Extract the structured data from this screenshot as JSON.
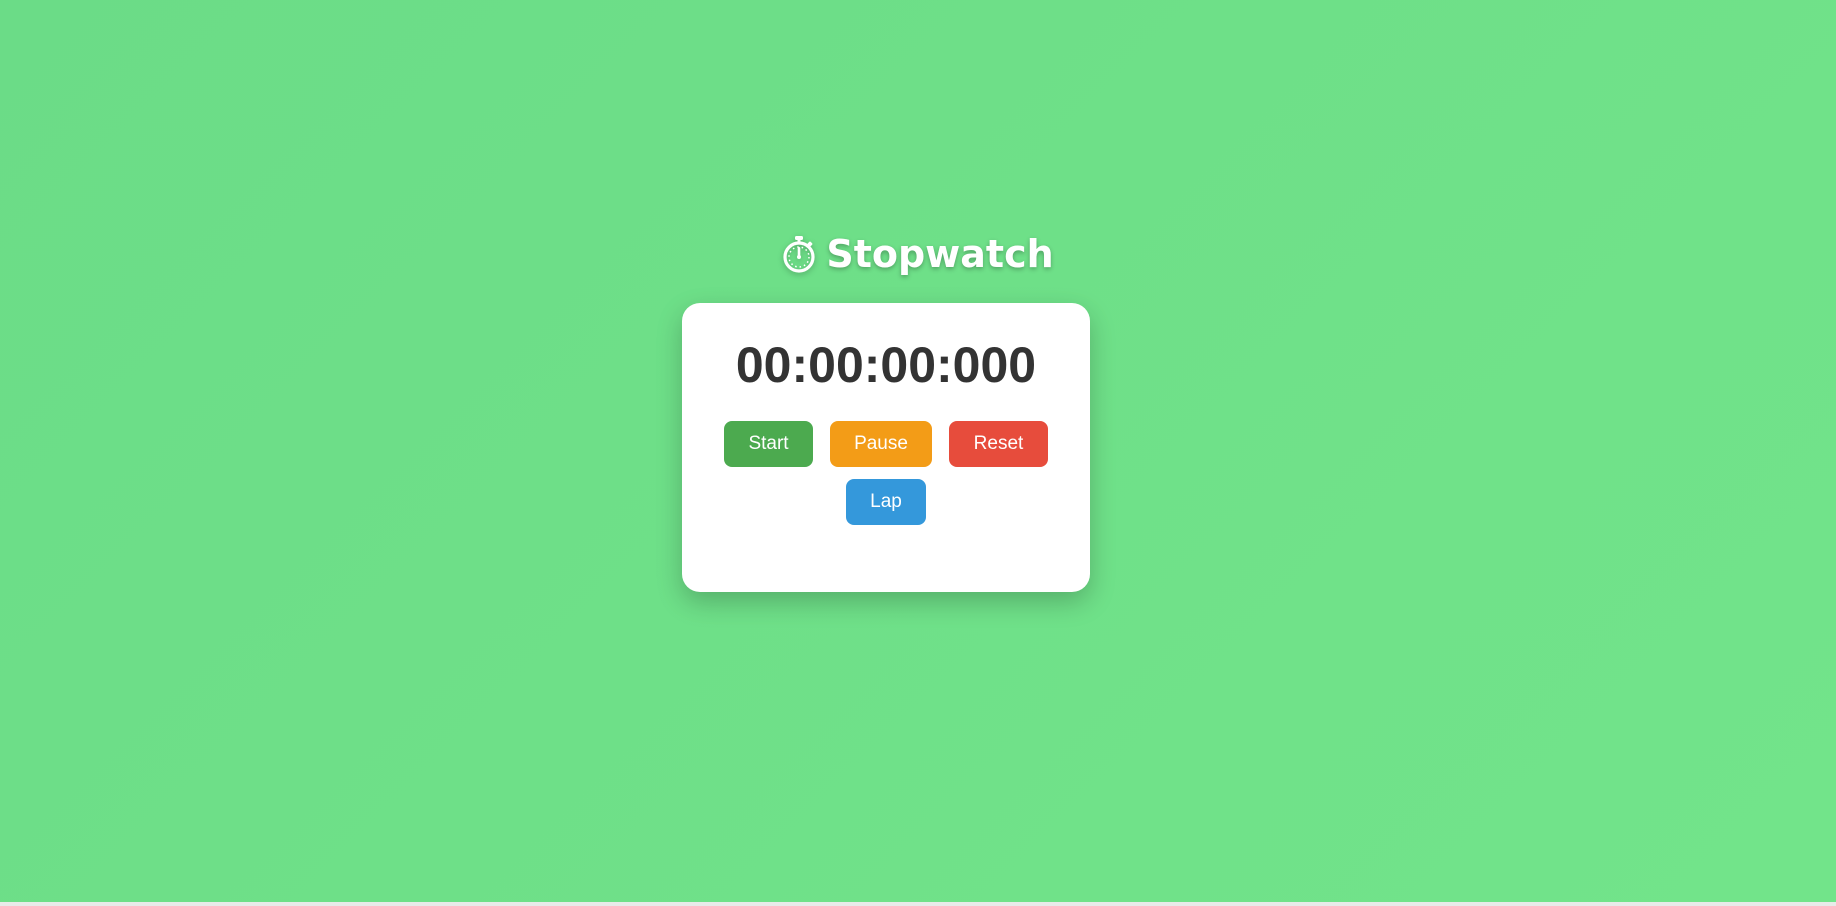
{
  "header": {
    "icon": "stopwatch-icon",
    "title": "Stopwatch"
  },
  "stopwatch": {
    "time": "00:00:00:000"
  },
  "controls": {
    "start_label": "Start",
    "pause_label": "Pause",
    "reset_label": "Reset",
    "lap_label": "Lap"
  },
  "colors": {
    "background": "#6ddf88",
    "card": "#ffffff",
    "start": "#4caa4f",
    "pause": "#f39c17",
    "reset": "#e74c3c",
    "lap": "#3498db",
    "time_text": "#333333"
  }
}
